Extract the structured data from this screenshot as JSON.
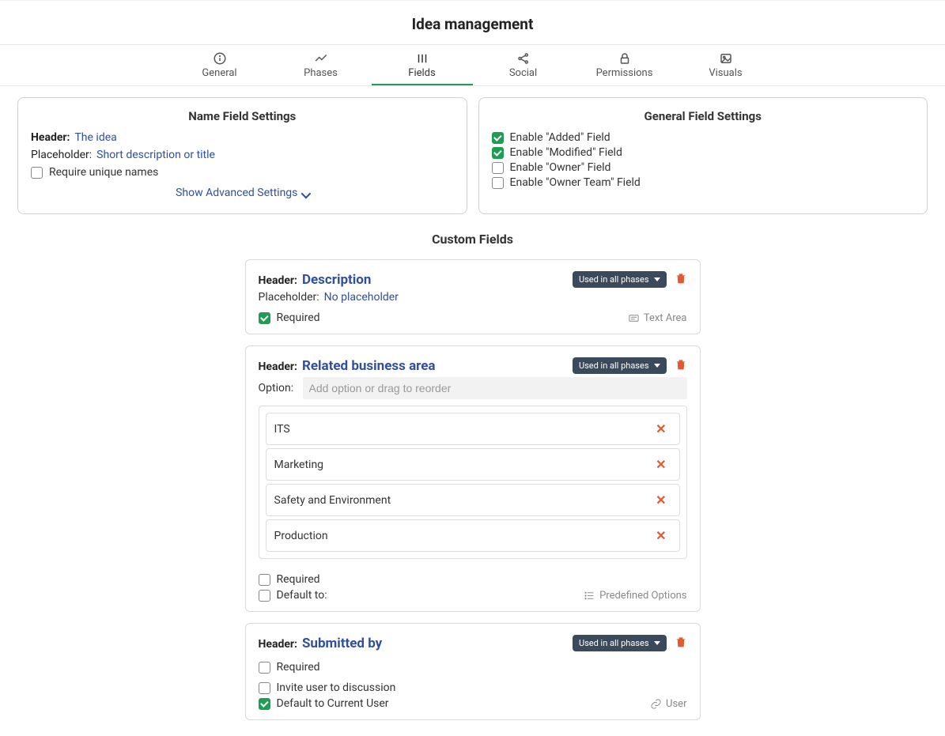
{
  "page_title": "Idea management",
  "tabs": [
    {
      "id": "general",
      "label": "General"
    },
    {
      "id": "phases",
      "label": "Phases"
    },
    {
      "id": "fields",
      "label": "Fields",
      "active": true
    },
    {
      "id": "social",
      "label": "Social"
    },
    {
      "id": "permissions",
      "label": "Permissions"
    },
    {
      "id": "visuals",
      "label": "Visuals"
    }
  ],
  "name_panel": {
    "title": "Name Field Settings",
    "header_label": "Header:",
    "header_value": "The idea",
    "placeholder_label": "Placeholder:",
    "placeholder_value": "Short description or title",
    "unique_label": "Require unique names",
    "unique_checked": false,
    "advanced_label": "Show Advanced Settings"
  },
  "general_panel": {
    "title": "General Field Settings",
    "rows": [
      {
        "label": "Enable \"Added\" Field",
        "checked": true
      },
      {
        "label": "Enable \"Modified\" Field",
        "checked": true
      },
      {
        "label": "Enable \"Owner\" Field",
        "checked": false
      },
      {
        "label": "Enable \"Owner Team\" Field",
        "checked": false
      }
    ]
  },
  "custom_title": "Custom Fields",
  "phase_pill_label": "Used in all phases",
  "labels": {
    "header": "Header:",
    "placeholder": "Placeholder:",
    "option": "Option:",
    "required": "Required",
    "default_to": "Default to:",
    "invite": "Invite user to discussion",
    "default_current": "Default to Current User"
  },
  "field1": {
    "header": "Description",
    "placeholder": "No placeholder",
    "required": true,
    "type_label": "Text Area"
  },
  "field2": {
    "header": "Related business area",
    "option_placeholder": "Add option or drag to reorder",
    "options": [
      "ITS",
      "Marketing",
      "Safety and Environment",
      "Production"
    ],
    "required": false,
    "type_label": "Predefined Options"
  },
  "field3": {
    "header": "Submitted by",
    "required": false,
    "invite": false,
    "default_current": true,
    "type_label": "User"
  }
}
